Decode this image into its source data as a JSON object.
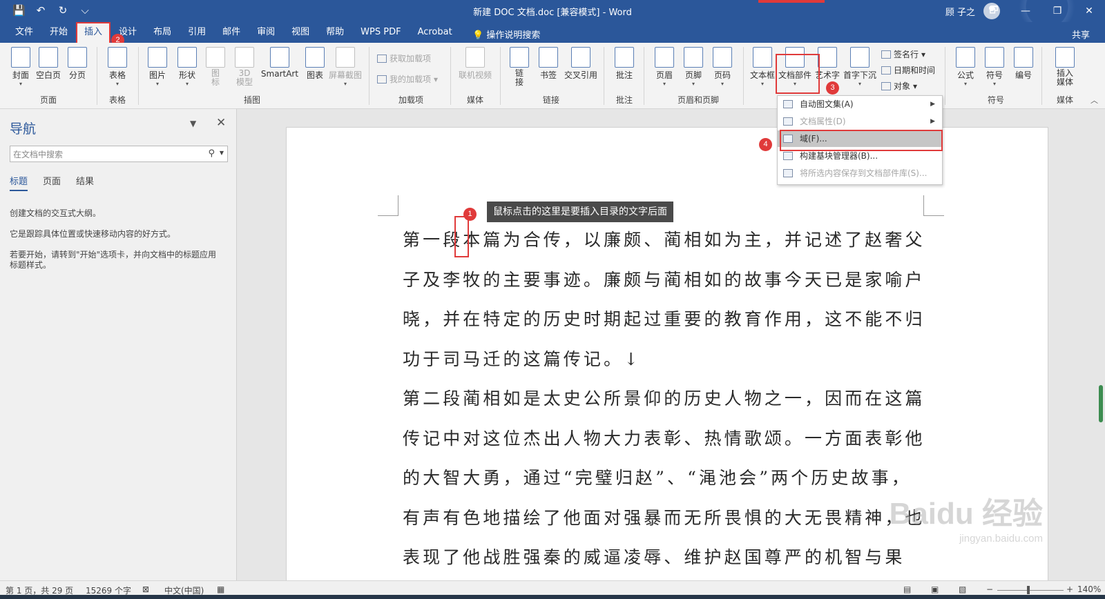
{
  "window": {
    "title": "新建 DOC 文档.doc [兼容模式] - Word",
    "user": "顾 子之",
    "qat": [
      "💾",
      "↶",
      "↻",
      "⌵"
    ],
    "controls": [
      "🗗",
      "—",
      "❐",
      "✕"
    ]
  },
  "menu_tabs": [
    "文件",
    "开始",
    "插入",
    "设计",
    "布局",
    "引用",
    "邮件",
    "审阅",
    "视图",
    "帮助",
    "WPS PDF",
    "Acrobat"
  ],
  "active_tab": "插入",
  "tell_me": "💡 操作说明搜索",
  "share": "共享",
  "ribbon": {
    "buttons": {
      "cover": "封面",
      "blank": "空白页",
      "break": "分页",
      "table": "表格",
      "picture": "图片",
      "shapes": "形状",
      "icons": "图\n标",
      "model3d": "3D\n模型",
      "smartart": "SmartArt",
      "chart": "图表",
      "screenshot": "屏幕截图",
      "online_video": "联机视频",
      "link": "链\n接",
      "bookmark": "书签",
      "crossref": "交叉引用",
      "comment": "批注",
      "header": "页眉",
      "footer": "页脚",
      "pagenum": "页码",
      "textbox": "文本框",
      "quickparts": "文档部件",
      "wordart": "艺术字",
      "dropcap": "首字下沉",
      "equation": "公式",
      "symbol": "符号",
      "number": "编号",
      "insert_media": "插入\n媒体"
    },
    "small": {
      "get_addins": "获取加载项",
      "my_addins": "我的加载项",
      "signature": "签名行",
      "datetime": "日期和时间",
      "object": "对象"
    },
    "groups": [
      "页面",
      "表格",
      "插图",
      "加载项",
      "媒体",
      "链接",
      "批注",
      "页眉和页脚",
      "符号",
      "媒体"
    ]
  },
  "nav": {
    "title": "导航",
    "search_placeholder": "在文档中搜索",
    "tabs": [
      "标题",
      "页面",
      "结果"
    ],
    "help": [
      "创建文档的交互式大纲。",
      "它是跟踪具体位置或快速移动内容的好方式。",
      "若要开始，请转到\"开始\"选项卡，并向文档中的标题应用标题样式。"
    ]
  },
  "dropdown": {
    "items": [
      {
        "label": "自动图文集(A)",
        "disabled": false,
        "submenu": true
      },
      {
        "label": "文档属性(D)",
        "disabled": true,
        "submenu": true
      },
      {
        "label": "域(F)...",
        "disabled": false,
        "submenu": false
      },
      {
        "label": "构建基块管理器(B)...",
        "disabled": false,
        "submenu": false
      },
      {
        "label": "将所选内容保存到文档部件库(S)...",
        "disabled": true,
        "submenu": false
      }
    ]
  },
  "tooltip": "鼠标点击的这里是要插入目录的文字后面",
  "badges": [
    "1",
    "2",
    "3",
    "4"
  ],
  "document": {
    "lines": [
      "第一段本篇为合传，以廉颇、蔺相如为主，并记述了赵奢父",
      "子及李牧的主要事迹。廉颇与蔺相如的故事今天已是家喻户",
      "晓，并在特定的历史时期起过重要的教育作用，这不能不归",
      "功于司马迁的这篇传记。↓",
      "第二段蔺相如是太史公所景仰的历史人物之一，因而在这篇",
      "传记中对这位杰出人物大力表彰、热情歌颂。一方面表彰他",
      "的大智大勇，通过“完璧归赵”、“渑池会”两个历史故事，",
      "有声有色地描绘了他面对强暴而无所畏惧的大无畏精神，也",
      "表现了他战胜强秦的威逼凌辱、维护赵国尊严的机智与果"
    ]
  },
  "watermark": {
    "main": "Baidu 经验",
    "sub": "jingyan.baidu.com"
  },
  "status": {
    "page": "第 1 页，共 29 页",
    "words": "15269 个字",
    "language": "中文(中国)",
    "zoom": "140%"
  }
}
